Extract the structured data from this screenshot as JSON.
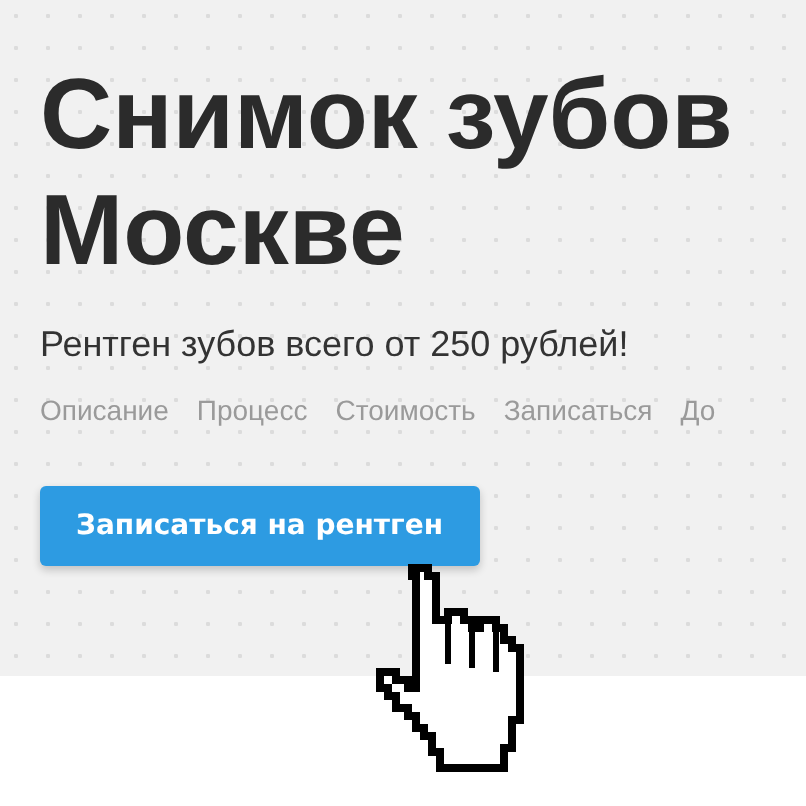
{
  "hero": {
    "headline": [
      "Снимок зубов",
      "Москве"
    ],
    "subtitle": "Рентген зубов всего от 250 рублей!",
    "nav": [
      "Описание",
      "Процесс",
      "Стоимость",
      "Записаться",
      "До"
    ],
    "button": "Записаться на рентген"
  }
}
